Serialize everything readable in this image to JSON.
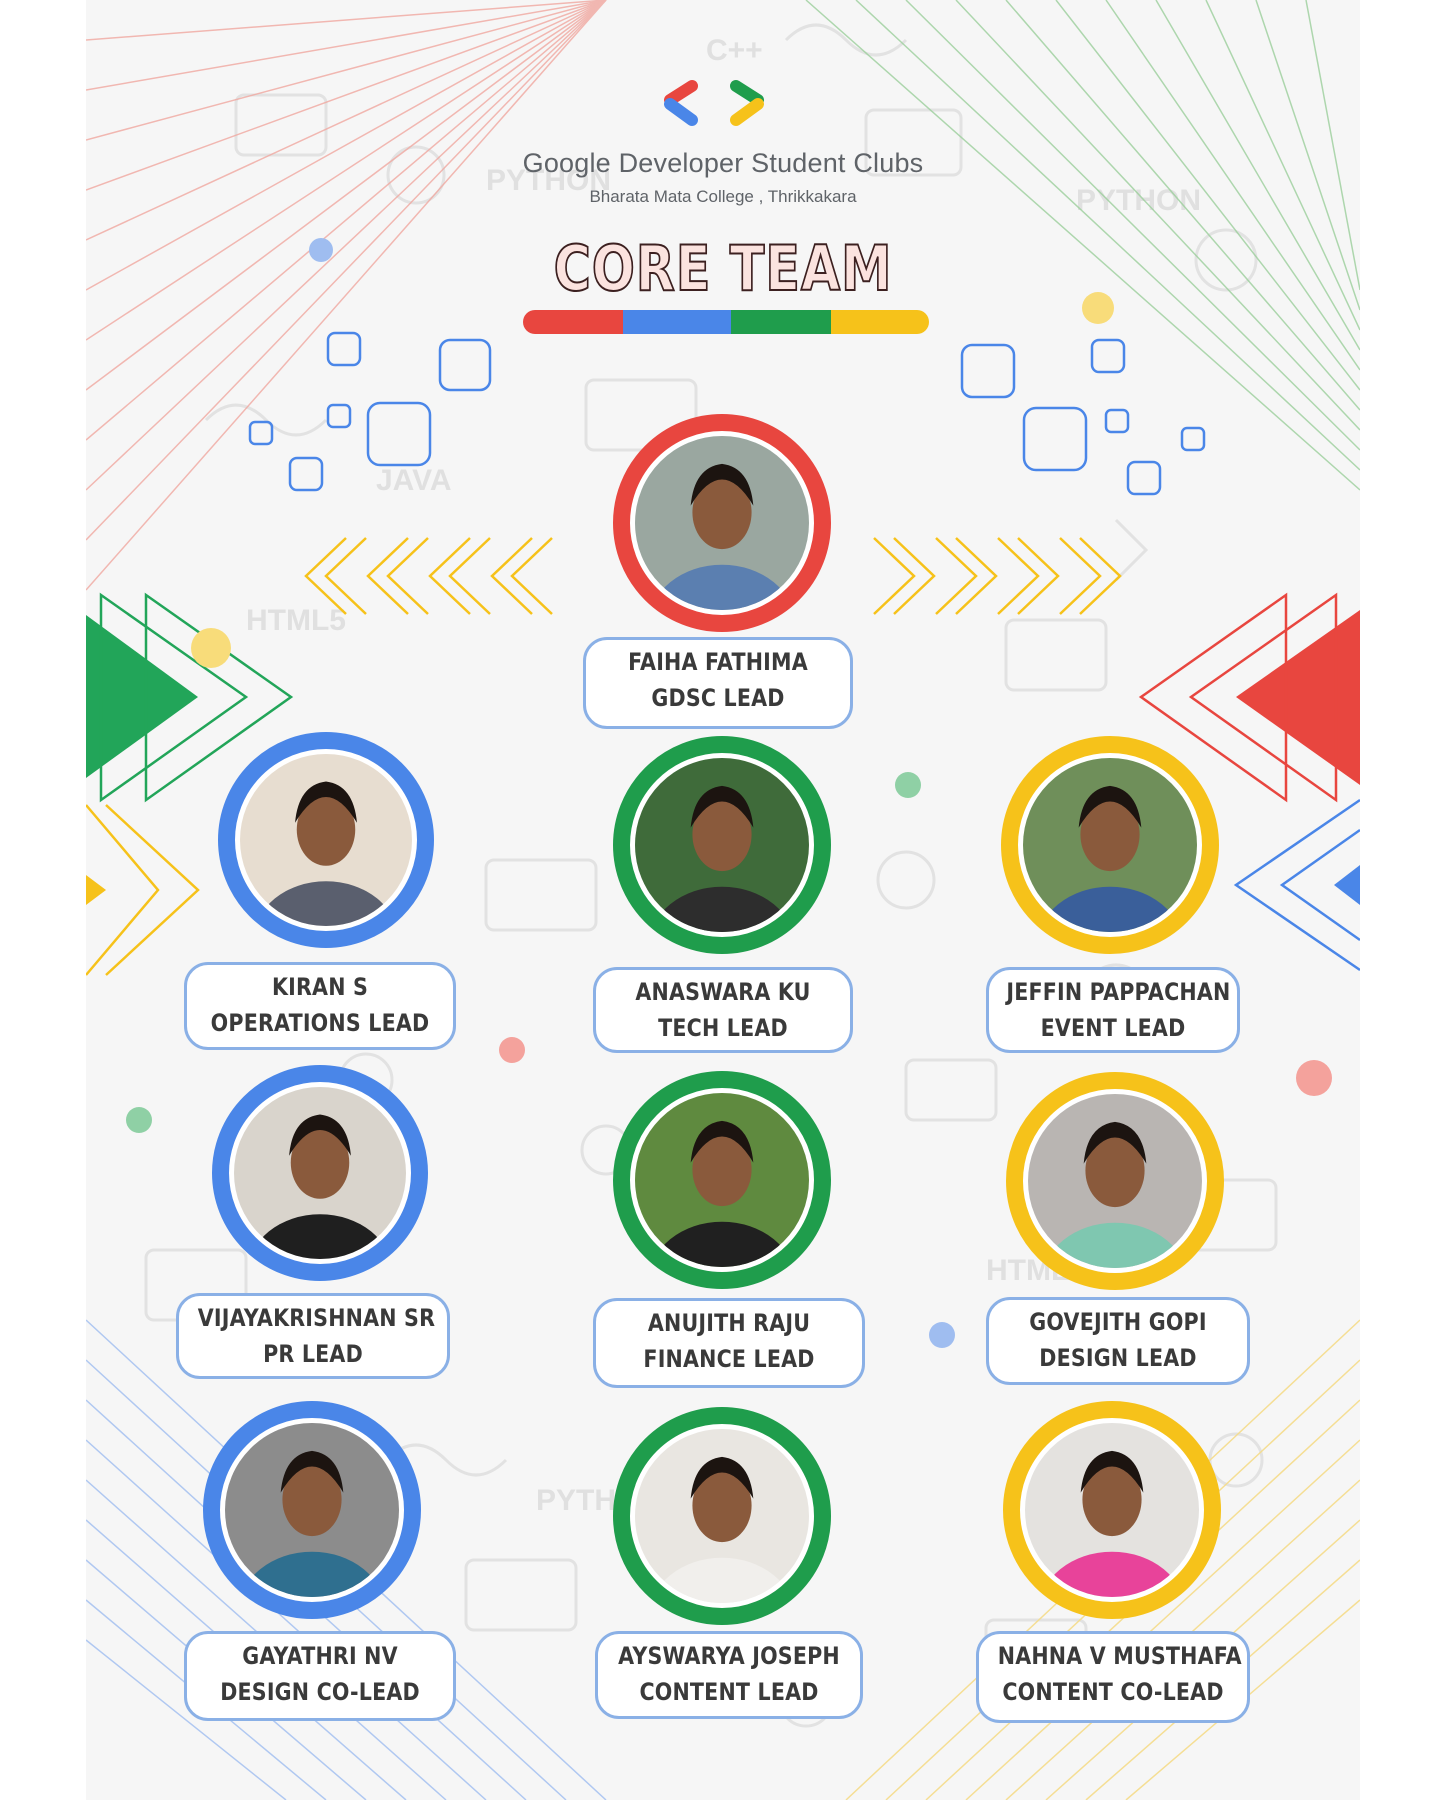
{
  "header": {
    "org_name": "Google Developer Student Clubs",
    "org_sub": "Bharata Mata College , Thrikkakara",
    "title": "CORE TEAM"
  },
  "colors": {
    "red": "#e8463f",
    "blue": "#4a86e8",
    "green": "#1f9d4c",
    "yellow": "#f6c21a",
    "label_border": "#8ab0e6"
  },
  "members": [
    {
      "name": "FAIHA FATHIMA",
      "role": "GDSC LEAD",
      "ring": "red"
    },
    {
      "name": "KIRAN S",
      "role": "OPERATIONS LEAD",
      "ring": "blue"
    },
    {
      "name": "ANASWARA KU",
      "role": "TECH LEAD",
      "ring": "green"
    },
    {
      "name": "JEFFIN PAPPACHAN",
      "role": "EVENT LEAD",
      "ring": "yellow"
    },
    {
      "name": "VIJAYAKRISHNAN SR",
      "role": "PR LEAD",
      "ring": "blue"
    },
    {
      "name": "ANUJITH RAJU",
      "role": "FINANCE LEAD",
      "ring": "green"
    },
    {
      "name": "GOVEJITH GOPI",
      "role": "DESIGN LEAD",
      "ring": "yellow"
    },
    {
      "name": "GAYATHRI NV",
      "role": "DESIGN CO-LEAD",
      "ring": "blue"
    },
    {
      "name": "AYSWARYA JOSEPH",
      "role": "CONTENT LEAD",
      "ring": "green"
    },
    {
      "name": "NAHNA V MUSTHAFA",
      "role": "CONTENT CO-LEAD",
      "ring": "yellow"
    }
  ]
}
